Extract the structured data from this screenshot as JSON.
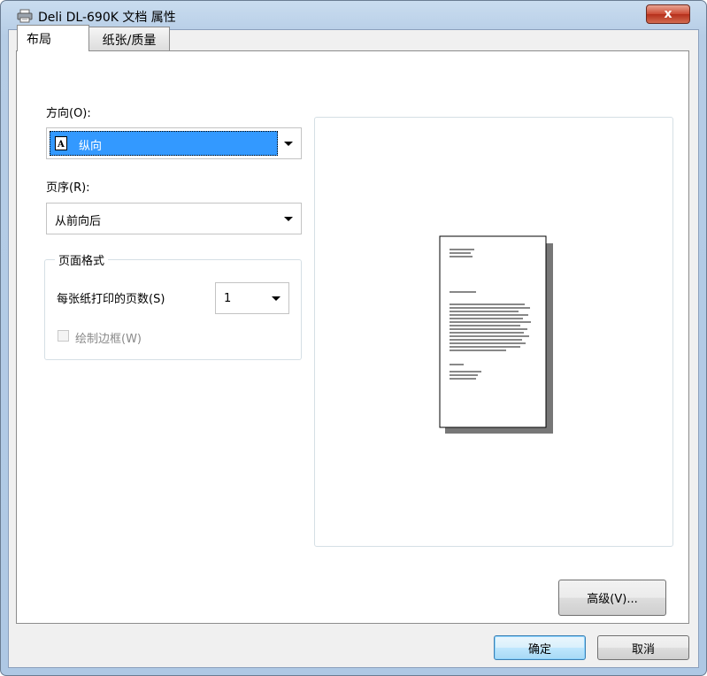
{
  "window": {
    "title": "Deli DL-690K 文档 属性",
    "close_label": "x",
    "icon": "printer-icon"
  },
  "tabs": [
    {
      "label": "布局",
      "active": true
    },
    {
      "label": "纸张/质量",
      "active": false
    }
  ],
  "orientation": {
    "label": "方向(O):",
    "value": "纵向",
    "icon": "portrait-page-icon"
  },
  "page_order": {
    "label": "页序(R):",
    "value": "从前向后"
  },
  "page_format": {
    "group_title": "页面格式",
    "pages_per_sheet_label": "每张纸打印的页数(S)",
    "pages_per_sheet_value": "1",
    "draw_borders_label": "绘制边框(W)",
    "draw_borders_checked": false,
    "draw_borders_enabled": false
  },
  "buttons": {
    "advanced": "高级(V)...",
    "ok": "确定",
    "cancel": "取消"
  },
  "colors": {
    "selection": "#3399ff",
    "close": "#c9452f"
  }
}
